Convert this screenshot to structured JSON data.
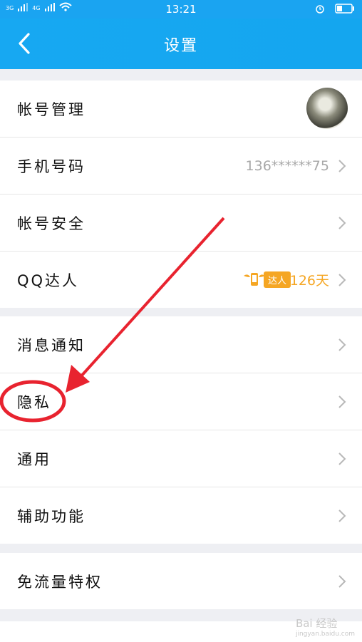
{
  "status": {
    "time": "13:21",
    "net1": "3G",
    "net2": "4G"
  },
  "header": {
    "title": "设置"
  },
  "group1": [
    {
      "label": "帐号管理"
    },
    {
      "label": "手机号码",
      "value": "136******75"
    },
    {
      "label": "帐号安全"
    },
    {
      "label": "QQ达人",
      "badge": "达人",
      "days": "126天"
    }
  ],
  "group2": [
    {
      "label": "消息通知"
    },
    {
      "label": "隐私"
    },
    {
      "label": "通用"
    },
    {
      "label": "辅助功能"
    }
  ],
  "group3": [
    {
      "label": "免流量特权"
    }
  ],
  "watermark": {
    "brand": "Bai 经验",
    "url": "jingyan.baidu.com"
  },
  "colors": {
    "accent": "#1aa4f1",
    "annotation": "#e8232f",
    "badge": "#f5a623"
  }
}
